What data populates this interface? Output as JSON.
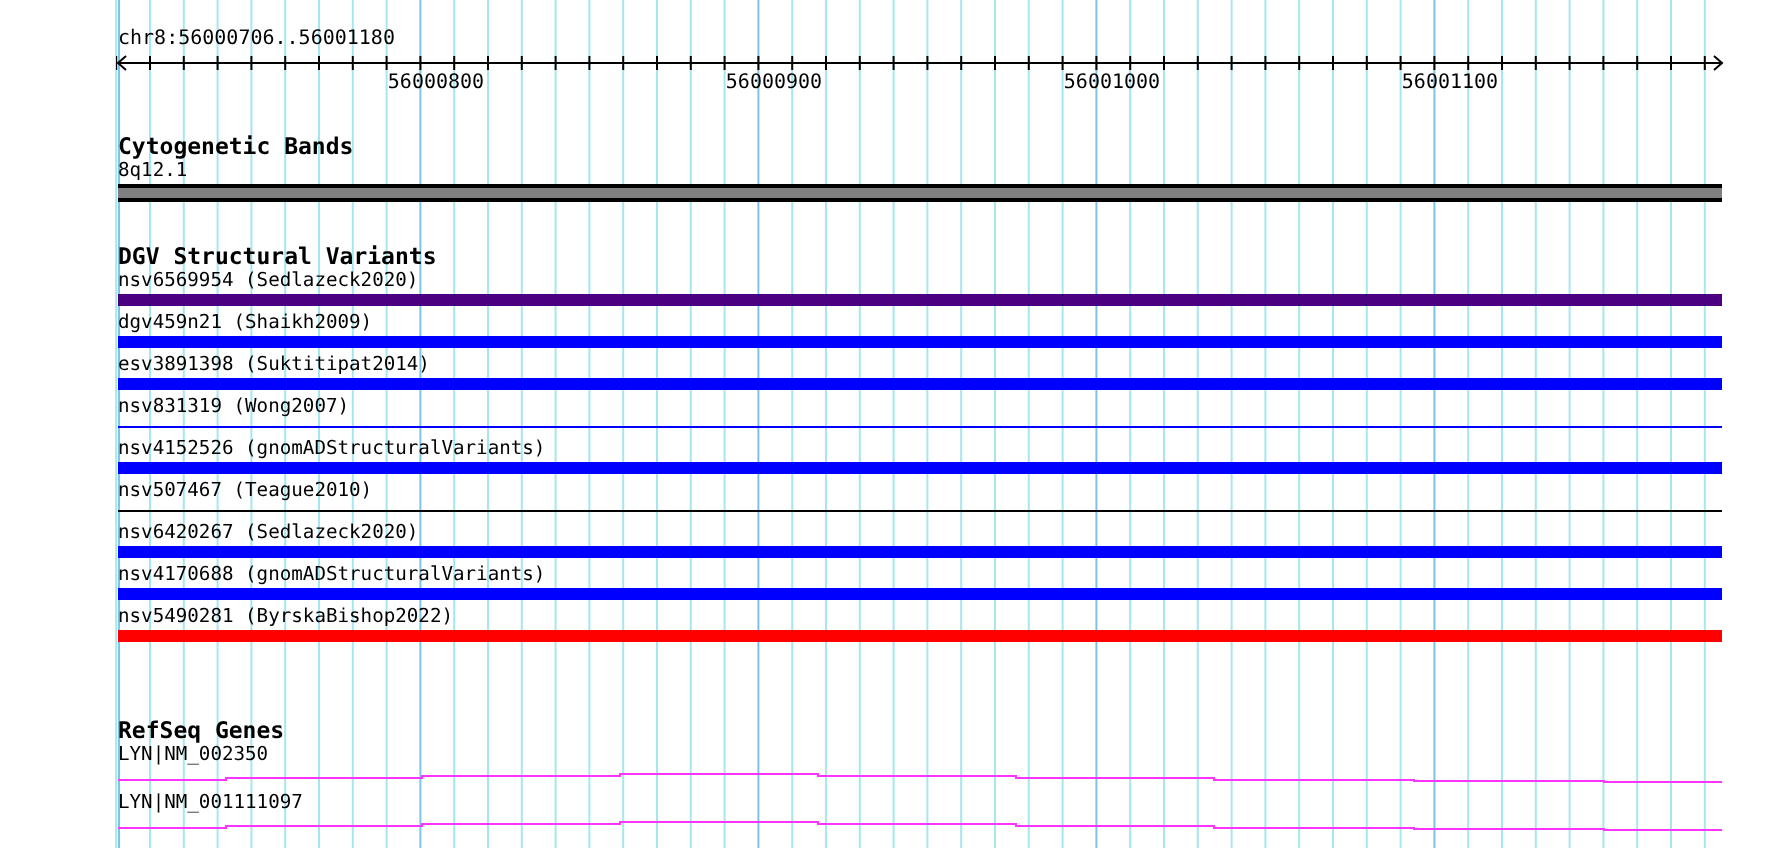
{
  "ruler": {
    "label": "chr8:56000706..56001180",
    "ticks": [
      "56000800",
      "56000900",
      "56001000",
      "56001100"
    ]
  },
  "cytobands": {
    "title": "Cytogenetic Bands",
    "features": [
      {
        "label": "8q12.1",
        "color": "#808080"
      }
    ]
  },
  "variants": {
    "title": "DGV Structural Variants",
    "features": [
      {
        "label": "nsv6569954 (Sedlazeck2020)",
        "kind": "bar",
        "color": "#4b0082"
      },
      {
        "label": "dgv459n21 (Shaikh2009)",
        "kind": "bar",
        "color": "#0000ff"
      },
      {
        "label": "esv3891398 (Suktitipat2014)",
        "kind": "bar",
        "color": "#0000ff"
      },
      {
        "label": "nsv831319 (Wong2007)",
        "kind": "line",
        "color": "#0000ff"
      },
      {
        "label": "nsv4152526 (gnomADStructuralVariants)",
        "kind": "bar",
        "color": "#0000ff"
      },
      {
        "label": "nsv507467 (Teague2010)",
        "kind": "line",
        "color": "#000000"
      },
      {
        "label": "nsv6420267 (Sedlazeck2020)",
        "kind": "bar",
        "color": "#0000ff"
      },
      {
        "label": "nsv4170688 (gnomADStructuralVariants)",
        "kind": "bar",
        "color": "#0000ff"
      },
      {
        "label": "nsv5490281 (ByrskaBishop2022)",
        "kind": "bar",
        "color": "#ff0000"
      }
    ]
  },
  "genes": {
    "title": "RefSeq Genes",
    "features": [
      {
        "label": "LYN|NM_002350"
      },
      {
        "label": "LYN|NM_001111097"
      }
    ]
  }
}
